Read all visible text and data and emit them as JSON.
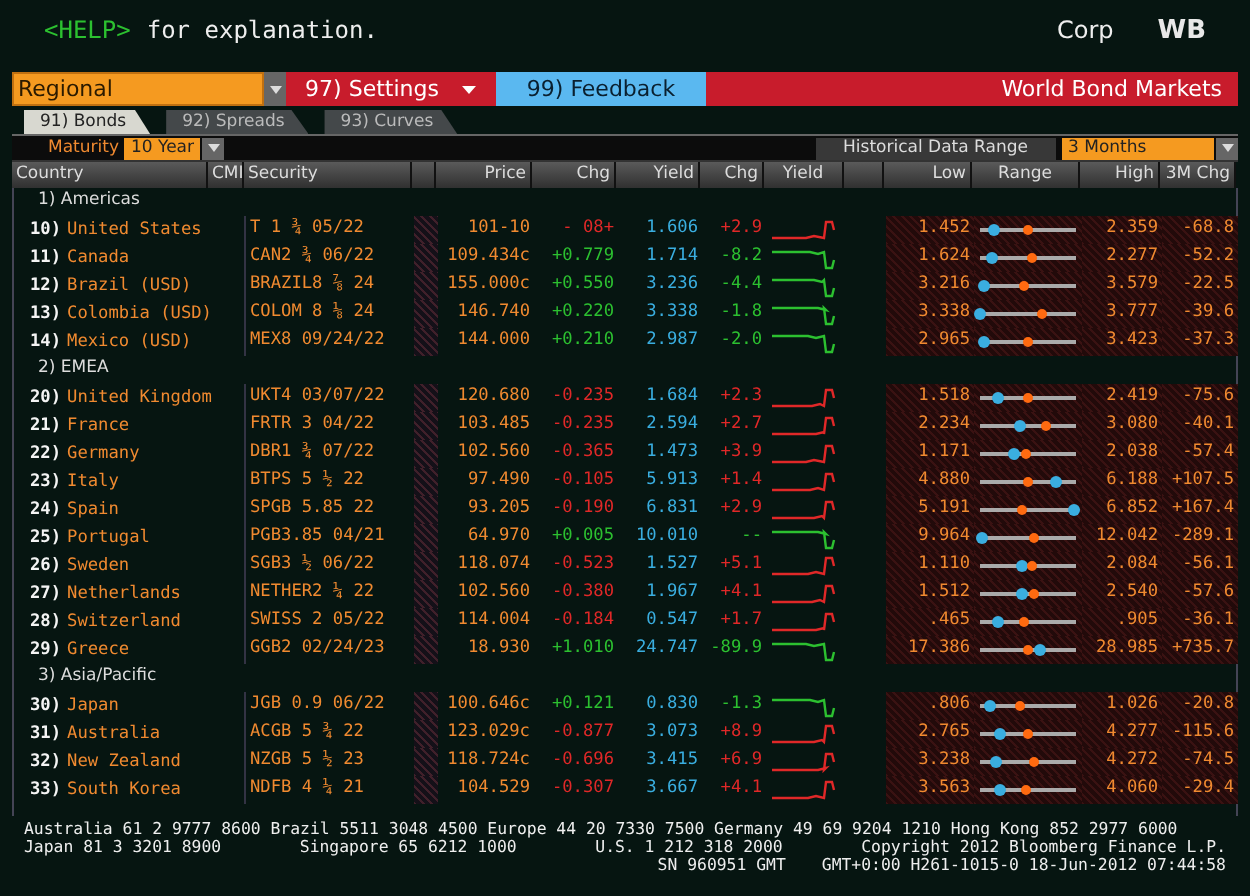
{
  "header": {
    "help_key": "<HELP>",
    "help_text": "for explanation.",
    "market": "Corp",
    "function": "WB"
  },
  "toolbar": {
    "region": "Regional",
    "settings": "97) Settings",
    "feedback": "99) Feedback",
    "title": "World Bond Markets"
  },
  "tabs": [
    {
      "label": "91) Bonds",
      "selected": true
    },
    {
      "label": "92) Spreads",
      "selected": false
    },
    {
      "label": "93) Curves",
      "selected": false
    }
  ],
  "filters": {
    "maturity_label": "Maturity",
    "maturity": "10 Year",
    "range_label": "Historical Data Range",
    "range": "3 Months"
  },
  "table": {
    "columns": [
      "Country",
      "CMI",
      "Security",
      "Price",
      "Chg",
      "Yield",
      "Chg",
      "Yield",
      "Low",
      "Range",
      "High",
      "3M Chg"
    ],
    "groups": [
      {
        "label": "1) Americas",
        "rows": [
          {
            "num": "10)",
            "country": "United States",
            "security": "T 1 ¾ 05/22",
            "price": "101-10",
            "price_chg": "- 08+",
            "yield": "1.606",
            "yield_chg": "+2.9",
            "gain": false,
            "low": "1.452",
            "markers": [
              {
                "kind": "current",
                "level": 0.15
              },
              {
                "kind": "average",
                "level": 0.5
              }
            ],
            "high": "2.359",
            "chg_3m": "-68.8"
          },
          {
            "num": "11)",
            "country": "Canada",
            "security": "CAN2 ¾ 06/22",
            "price": "109.434c",
            "price_chg": "+0.779",
            "yield": "1.714",
            "yield_chg": "-8.2",
            "gain": true,
            "low": "1.624",
            "markers": [
              {
                "kind": "current",
                "level": 0.13
              },
              {
                "kind": "average",
                "level": 0.55
              }
            ],
            "high": "2.277",
            "chg_3m": "-52.2"
          },
          {
            "num": "12)",
            "country": "Brazil (USD)",
            "security": "BRAZIL8 ⅞ 24",
            "price": "155.000c",
            "price_chg": "+0.550",
            "yield": "3.236",
            "yield_chg": "-4.4",
            "gain": true,
            "low": "3.216",
            "markers": [
              {
                "kind": "current",
                "level": 0.04
              },
              {
                "kind": "average",
                "level": 0.46
              }
            ],
            "high": "3.579",
            "chg_3m": "-22.5"
          },
          {
            "num": "13)",
            "country": "Colombia (USD)",
            "security": "COLOM 8 ⅛ 24",
            "price": "146.740",
            "price_chg": "+0.220",
            "yield": "3.338",
            "yield_chg": "-1.8",
            "gain": true,
            "low": "3.338",
            "markers": [
              {
                "kind": "current",
                "level": 0.0
              },
              {
                "kind": "average",
                "level": 0.65
              }
            ],
            "high": "3.777",
            "chg_3m": "-39.6"
          },
          {
            "num": "14)",
            "country": "Mexico (USD)",
            "security": "MEX8 09/24/22",
            "price": "144.000",
            "price_chg": "+0.210",
            "yield": "2.987",
            "yield_chg": "-2.0",
            "gain": true,
            "low": "2.965",
            "markers": [
              {
                "kind": "current",
                "level": 0.05
              },
              {
                "kind": "average",
                "level": 0.5
              }
            ],
            "high": "3.423",
            "chg_3m": "-37.3"
          }
        ]
      },
      {
        "label": "2) EMEA",
        "rows": [
          {
            "num": "20)",
            "country": "United Kingdom",
            "security": "UKT4 03/07/22",
            "price": "120.680",
            "price_chg": "-0.235",
            "yield": "1.684",
            "yield_chg": "+2.3",
            "gain": false,
            "low": "1.518",
            "markers": [
              {
                "kind": "current",
                "level": 0.18
              },
              {
                "kind": "average",
                "level": 0.49
              }
            ],
            "high": "2.419",
            "chg_3m": "-75.6"
          },
          {
            "num": "21)",
            "country": "France",
            "security": "FRTR 3 04/22",
            "price": "103.485",
            "price_chg": "-0.235",
            "yield": "2.594",
            "yield_chg": "+2.7",
            "gain": false,
            "low": "2.234",
            "markers": [
              {
                "kind": "current",
                "level": 0.42
              },
              {
                "kind": "average",
                "level": 0.68
              }
            ],
            "high": "3.080",
            "chg_3m": "-40.1"
          },
          {
            "num": "22)",
            "country": "Germany",
            "security": "DBR1 ¾ 07/22",
            "price": "102.560",
            "price_chg": "-0.365",
            "yield": "1.473",
            "yield_chg": "+3.9",
            "gain": false,
            "low": "1.171",
            "markers": [
              {
                "kind": "current",
                "level": 0.35
              },
              {
                "kind": "average",
                "level": 0.47
              }
            ],
            "high": "2.038",
            "chg_3m": "-57.4"
          },
          {
            "num": "23)",
            "country": "Italy",
            "security": "BTPS 5 ½ 22",
            "price": "97.490",
            "price_chg": "-0.105",
            "yield": "5.913",
            "yield_chg": "+1.4",
            "gain": false,
            "low": "4.880",
            "markers": [
              {
                "kind": "current",
                "level": 0.8
              },
              {
                "kind": "average",
                "level": 0.5
              }
            ],
            "high": "6.188",
            "chg_3m": "+107.5"
          },
          {
            "num": "24)",
            "country": "Spain",
            "security": "SPGB 5.85 22",
            "price": "93.205",
            "price_chg": "-0.190",
            "yield": "6.831",
            "yield_chg": "+2.9",
            "gain": false,
            "low": "5.191",
            "markers": [
              {
                "kind": "current",
                "level": 0.98
              },
              {
                "kind": "average",
                "level": 0.43
              }
            ],
            "high": "6.852",
            "chg_3m": "+167.4"
          },
          {
            "num": "25)",
            "country": "Portugal",
            "security": "PGB3.85 04/21",
            "price": "64.970",
            "price_chg": "+0.005",
            "yield": "10.010",
            "yield_chg": "--",
            "gain": true,
            "low": "9.964",
            "markers": [
              {
                "kind": "current",
                "level": 0.02
              },
              {
                "kind": "average",
                "level": 0.57
              }
            ],
            "high": "12.042",
            "chg_3m": "-289.1"
          },
          {
            "num": "26)",
            "country": "Sweden",
            "security": "SGB3 ½ 06/22",
            "price": "118.074",
            "price_chg": "-0.523",
            "yield": "1.527",
            "yield_chg": "+5.1",
            "gain": false,
            "low": "1.110",
            "markers": [
              {
                "kind": "current",
                "level": 0.43
              },
              {
                "kind": "average",
                "level": 0.55
              }
            ],
            "high": "2.084",
            "chg_3m": "-56.1"
          },
          {
            "num": "27)",
            "country": "Netherlands",
            "security": "NETHER2 ¼ 22",
            "price": "102.560",
            "price_chg": "-0.380",
            "yield": "1.967",
            "yield_chg": "+4.1",
            "gain": false,
            "low": "1.512",
            "markers": [
              {
                "kind": "current",
                "level": 0.44
              },
              {
                "kind": "average",
                "level": 0.56
              }
            ],
            "high": "2.540",
            "chg_3m": "-57.6"
          },
          {
            "num": "28)",
            "country": "Switzerland",
            "security": "SWISS 2 05/22",
            "price": "114.004",
            "price_chg": "-0.184",
            "yield": "0.547",
            "yield_chg": "+1.7",
            "gain": false,
            "low": ".465",
            "markers": [
              {
                "kind": "current",
                "level": 0.18
              },
              {
                "kind": "average",
                "level": 0.45
              }
            ],
            "high": ".905",
            "chg_3m": "-36.1"
          },
          {
            "num": "29)",
            "country": "Greece",
            "security": "GGB2 02/24/23",
            "price": "18.930",
            "price_chg": "+1.010",
            "yield": "24.747",
            "yield_chg": "-89.9",
            "gain": true,
            "low": "17.386",
            "markers": [
              {
                "kind": "current",
                "level": 0.62
              },
              {
                "kind": "average",
                "level": 0.5
              }
            ],
            "high": "28.985",
            "chg_3m": "+735.7"
          }
        ]
      },
      {
        "label": "3) Asia/Pacific",
        "rows": [
          {
            "num": "30)",
            "country": "Japan",
            "security": "JGB 0.9 06/22",
            "price": "100.646c",
            "price_chg": "+0.121",
            "yield": "0.830",
            "yield_chg": "-1.3",
            "gain": true,
            "low": ".806",
            "markers": [
              {
                "kind": "current",
                "level": 0.1
              },
              {
                "kind": "average",
                "level": 0.42
              }
            ],
            "high": "1.026",
            "chg_3m": "-20.8"
          },
          {
            "num": "31)",
            "country": "Australia",
            "security": "ACGB 5 ¾ 22",
            "price": "123.029c",
            "price_chg": "-0.877",
            "yield": "3.073",
            "yield_chg": "+8.9",
            "gain": false,
            "low": "2.765",
            "markers": [
              {
                "kind": "current",
                "level": 0.2
              },
              {
                "kind": "average",
                "level": 0.5
              }
            ],
            "high": "4.277",
            "chg_3m": "-115.6"
          },
          {
            "num": "32)",
            "country": "New Zealand",
            "security": "NZGB 5 ½ 23",
            "price": "118.724c",
            "price_chg": "-0.696",
            "yield": "3.415",
            "yield_chg": "+6.9",
            "gain": false,
            "low": "3.238",
            "markers": [
              {
                "kind": "current",
                "level": 0.16
              },
              {
                "kind": "average",
                "level": 0.56
              }
            ],
            "high": "4.272",
            "chg_3m": "-74.5"
          },
          {
            "num": "33)",
            "country": "South Korea",
            "security": "NDFB 4 ¼ 21",
            "price": "104.529",
            "price_chg": "-0.307",
            "yield": "3.667",
            "yield_chg": "+4.1",
            "gain": false,
            "low": "3.563",
            "markers": [
              {
                "kind": "current",
                "level": 0.2
              },
              {
                "kind": "average",
                "level": 0.48
              }
            ],
            "high": "4.060",
            "chg_3m": "-29.4"
          }
        ]
      }
    ]
  },
  "footer": {
    "line1": "Australia 61 2 9777 8600 Brazil 5511 3048 4500 Europe 44 20 7330 7500 Germany 49 69 9204 1210 Hong Kong 852 2977 6000",
    "line2": [
      "Japan 81 3 3201 8900",
      "Singapore 65 6212 1000",
      "U.S. 1 212 318 2000",
      "Copyright 2012 Bloomberg Finance L.P."
    ],
    "line3": [
      "SN 960951 GMT",
      "GMT+0:00 H261-1015-0 18-Jun-2012 07:44:58"
    ]
  }
}
